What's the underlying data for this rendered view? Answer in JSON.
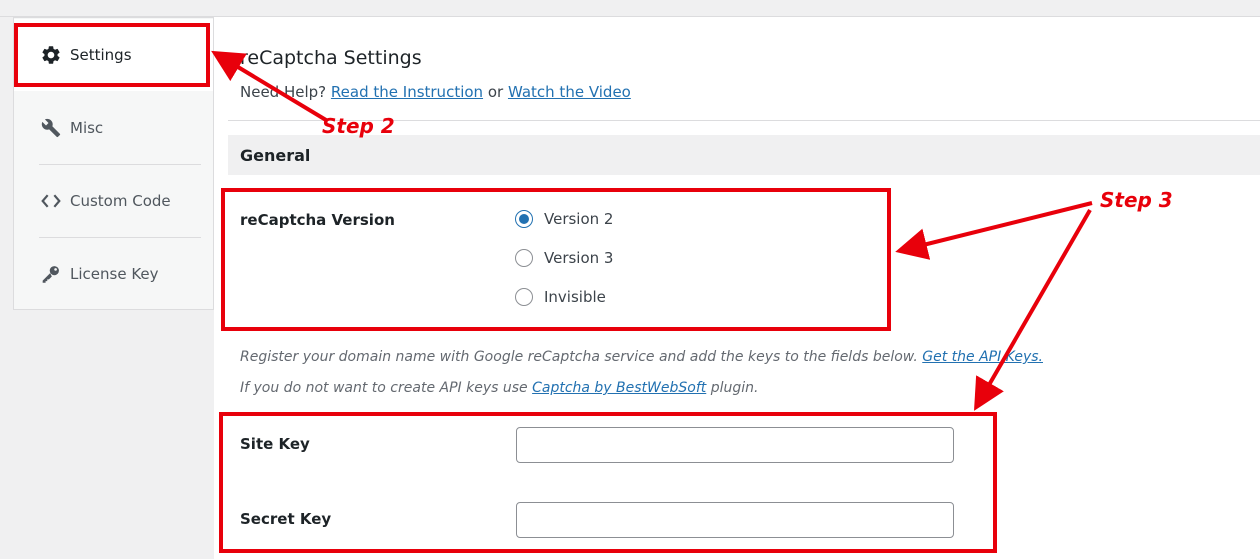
{
  "sidebar": {
    "items": [
      {
        "label": "Settings",
        "icon": "gear-icon",
        "active": true
      },
      {
        "label": "Misc",
        "icon": "wrench-icon",
        "active": false
      },
      {
        "label": "Custom Code",
        "icon": "code-icon",
        "active": false
      },
      {
        "label": "License Key",
        "icon": "key-icon",
        "active": false
      }
    ]
  },
  "main": {
    "title": "reCaptcha Settings",
    "help": {
      "prefix": "Need Help?",
      "link1": "Read the Instruction",
      "middle": "or",
      "link2": "Watch the Video"
    },
    "section_title": "General",
    "version": {
      "label": "reCaptcha Version",
      "options": [
        {
          "label": "Version 2",
          "checked": true
        },
        {
          "label": "Version 3",
          "checked": false
        },
        {
          "label": "Invisible",
          "checked": false
        }
      ]
    },
    "description1": {
      "text": "Register your domain name with Google reCaptcha service and add the keys to the fields below.",
      "link": "Get the API Keys."
    },
    "description2": {
      "prefix": "If you do not want to create API keys use",
      "link": "Captcha by BestWebSoft",
      "suffix": "plugin."
    },
    "site_key": {
      "label": "Site Key",
      "value": ""
    },
    "secret_key": {
      "label": "Secret Key",
      "value": ""
    }
  },
  "annotations": {
    "step2": "Step 2",
    "step3": "Step 3",
    "color": "#e8000b"
  },
  "colors": {
    "accent": "#2271b1",
    "background": "#f0f0f1"
  }
}
